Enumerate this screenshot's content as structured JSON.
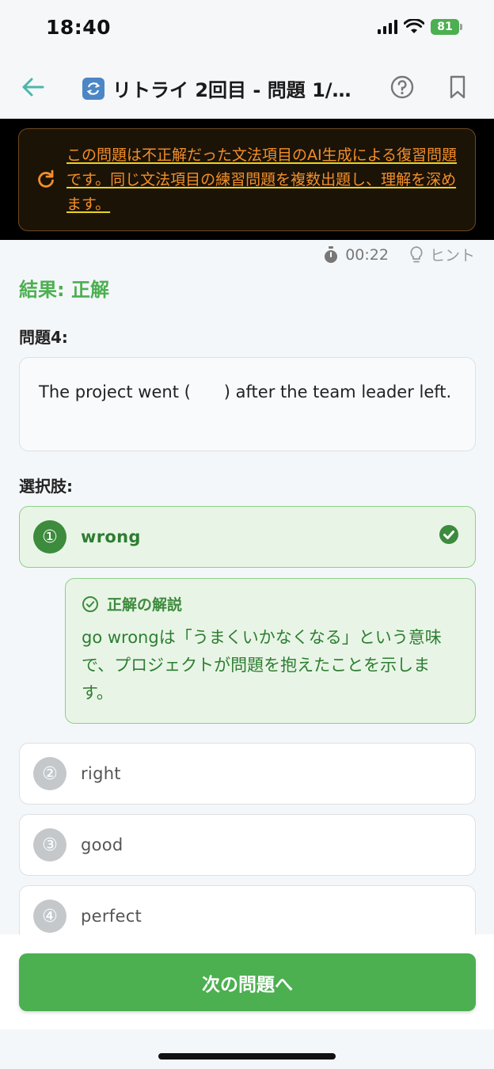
{
  "status": {
    "time": "18:40",
    "battery": "81"
  },
  "nav": {
    "title": "リトライ 2回目 - 問題 1/..."
  },
  "banner": {
    "text": "この問題は不正解だった文法項目のAI生成による復習問題です。同じ文法項目の練習問題を複数出題し、理解を深めます。"
  },
  "meta": {
    "timer": "00:22",
    "hint": "ヒント"
  },
  "result": "結果: 正解",
  "question": {
    "label": "問題4:",
    "text": "The project went (　　) after the team leader left."
  },
  "choices_label": "選択肢:",
  "options": [
    {
      "num": "①",
      "label": "wrong"
    },
    {
      "num": "②",
      "label": "right"
    },
    {
      "num": "③",
      "label": "good"
    },
    {
      "num": "④",
      "label": "perfect"
    }
  ],
  "explanation": {
    "title": "正解の解説",
    "body": "go wrongは「うまくいかなくなる」という意味で、プロジェクトが問題を抱えたことを示します。"
  },
  "next_button": "次の問題へ",
  "colors": {
    "accent": "#4caf50",
    "warning": "#f28f2b",
    "back_arrow": "#4db6ac"
  }
}
